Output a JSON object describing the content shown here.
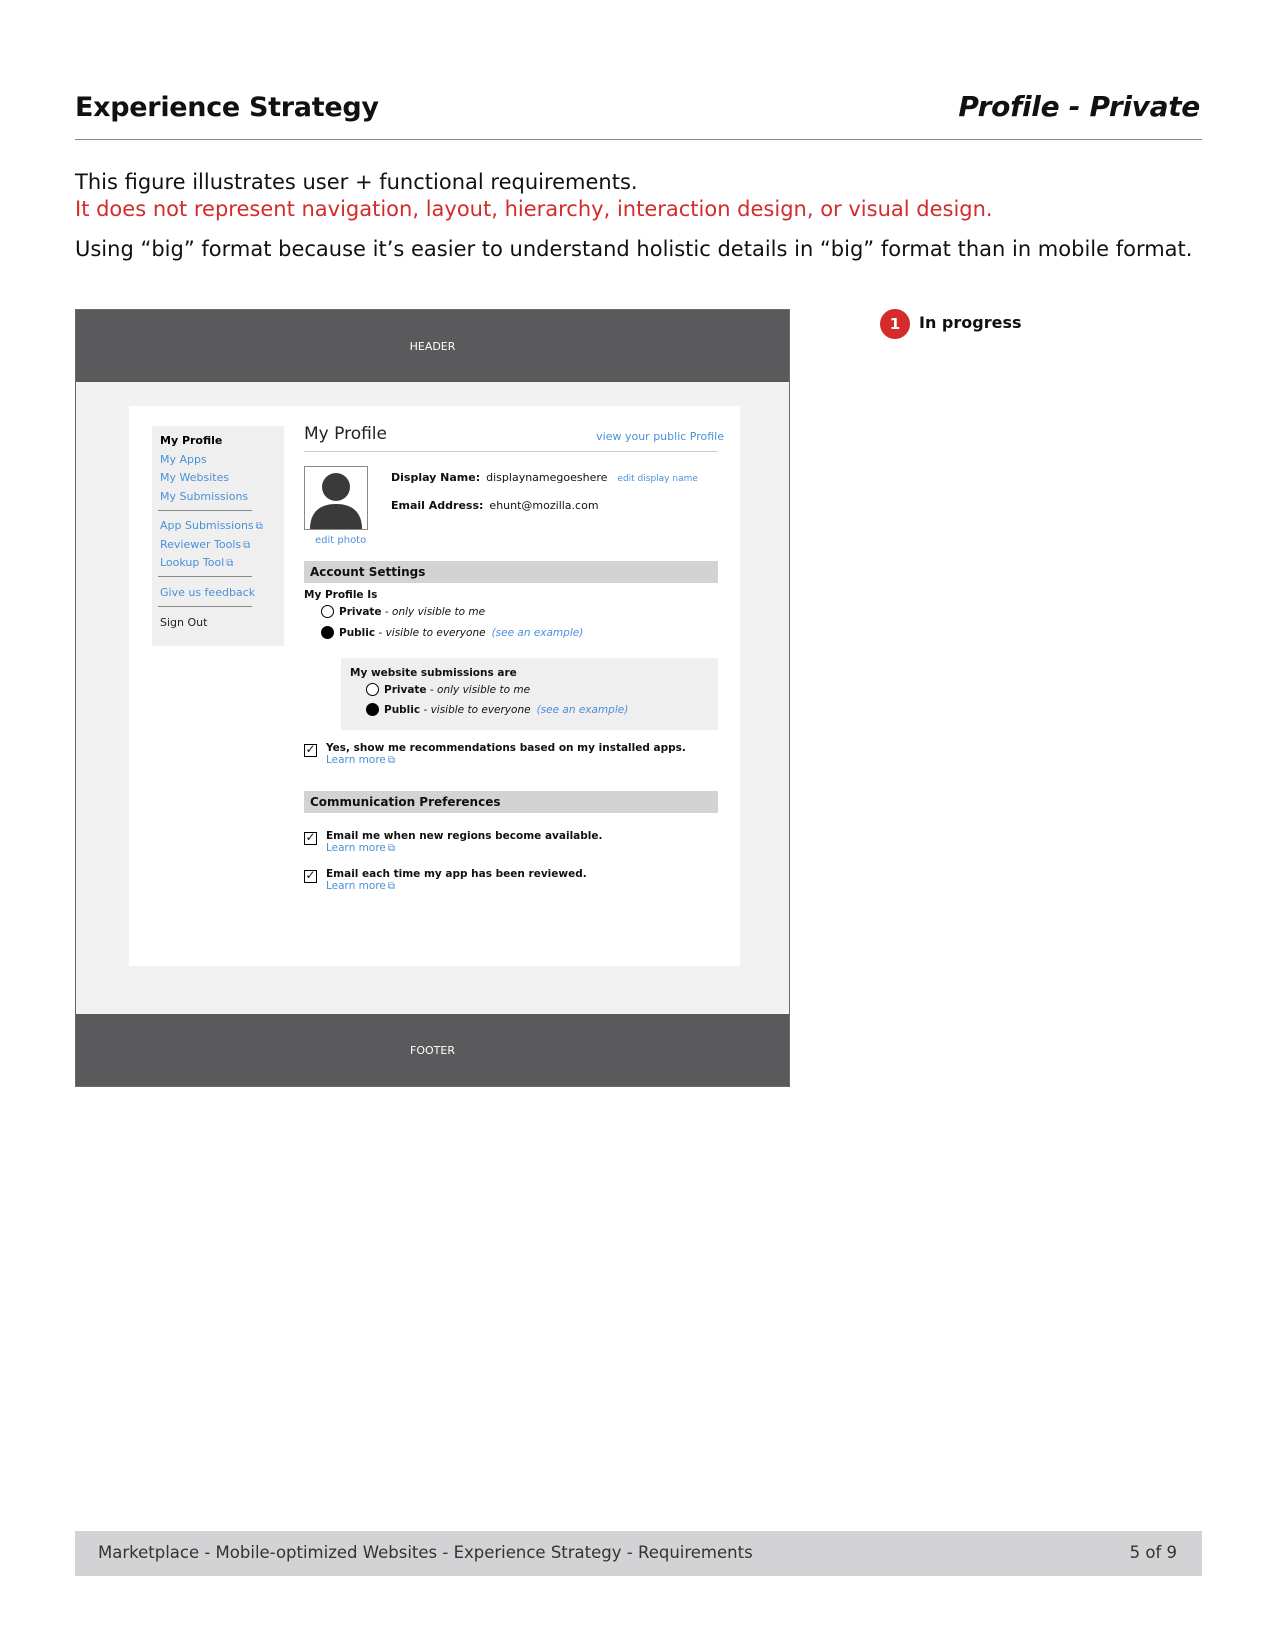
{
  "page": {
    "doc_title": "Experience Strategy",
    "page_label": "Profile - Private",
    "intro": [
      "This figure illustrates user + functional requirements.",
      "It does not represent navigation, layout, hierarchy, interaction design, or visual design.",
      "Using “big” format because it’s easier to understand holistic details in “big” format than in mobile format."
    ]
  },
  "colors": {
    "accent_red": "#d42b2b",
    "link_blue": "#4a90d9",
    "chrome_gray": "#5a5a5c",
    "section_gray": "#d3d3d3"
  },
  "wireframe": {
    "header": "HEADER",
    "footer": "FOOTER",
    "sidenav": {
      "items": [
        "My Profile",
        "My Apps",
        "My Websites",
        "My Submissions"
      ],
      "tools": [
        "App Submissions",
        "Reviewer Tools",
        "Lookup Tool"
      ],
      "feedback": "Give us feedback",
      "sign_out": "Sign Out",
      "external_icon": "external-link-icon"
    },
    "profile": {
      "title": "My Profile",
      "public_link": "view your public Profile",
      "edit_photo": "edit photo",
      "avatar_icon": "user-silhouette-icon",
      "display_name_label": "Display Name:",
      "display_name_value": "displaynamegoeshere",
      "edit_display_name": "edit display name",
      "email_label": "Email Address:",
      "email_value": "ehunt@mozilla.com"
    },
    "account_settings": {
      "heading": "Account Settings",
      "profile_is_label": "My Profile Is",
      "private_label": "Private",
      "private_desc": "only visible to me",
      "public_label": "Public",
      "public_desc": "visible to everyone",
      "see_example": "(see an example)",
      "selected": "Public",
      "websites_label": "My website submissions are",
      "websites_selected": "Public",
      "recommendations_text": "Yes, show me recommendations based on my installed apps.",
      "learn_more": "Learn more",
      "recommendations_checked": true
    },
    "communication": {
      "heading": "Communication Preferences",
      "items": [
        {
          "text": "Email me when new regions become available.",
          "learn_more": "Learn more",
          "checked": true
        },
        {
          "text": "Email each time my app has been reviewed.",
          "learn_more": "Learn more",
          "checked": true
        }
      ]
    }
  },
  "status": {
    "number": "1",
    "label": "In progress"
  },
  "footer": {
    "text": "Marketplace - Mobile-optimized Websites - Experience Strategy - Requirements",
    "page_number": "5 of 9"
  }
}
